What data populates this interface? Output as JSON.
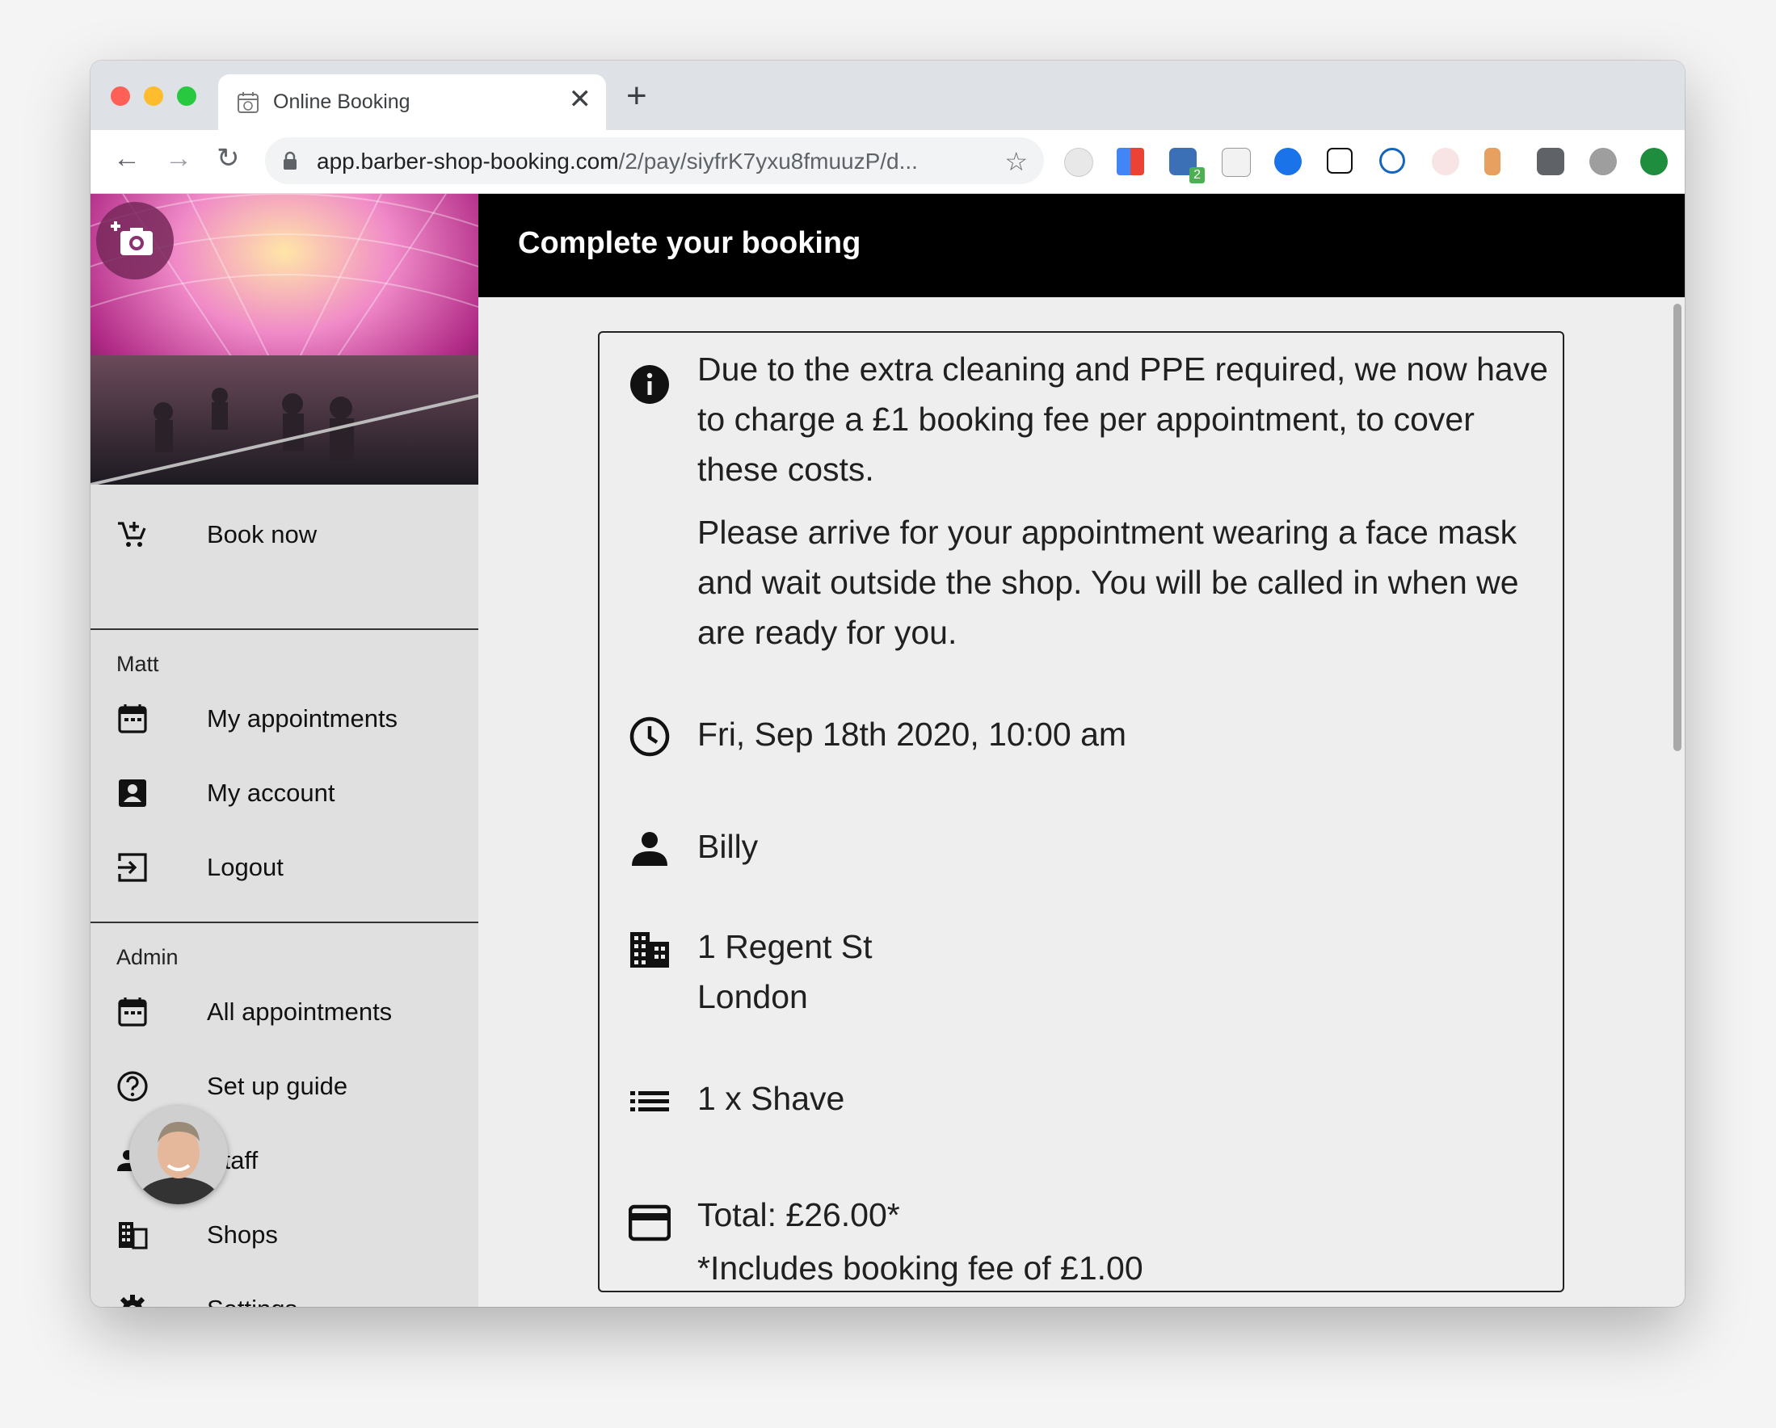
{
  "browser": {
    "tab_title": "Online Booking",
    "tab_close": "✕",
    "new_tab": "+",
    "url_main": "app.barber-shop-booking.com",
    "url_rest": "/2/pay/siyfrK7yxu8fmuuzP/d...",
    "back": "←",
    "forward": "→",
    "reload": "↻",
    "bookmark": "☆",
    "extension_badge": "2"
  },
  "sidebar": {
    "book_now": "Book now",
    "user_section": "Matt",
    "user_items": [
      "My appointments",
      "My account",
      "Logout"
    ],
    "admin_section": "Admin",
    "admin_items": [
      "All appointments",
      "Set up guide",
      "Staff",
      "Shops",
      "Settings"
    ]
  },
  "header": {
    "title": "Complete your booking"
  },
  "booking": {
    "notice_p1": "Due to the extra cleaning and PPE required, we now have to charge a £1 booking fee per appointment, to cover these costs.",
    "notice_p2": "Please arrive for your appointment wearing a face mask and wait outside the shop. You will be called in when we are ready for you.",
    "datetime": "Fri, Sep 18th 2020, 10:00 am",
    "staff": "Billy",
    "address_line1": "1 Regent St",
    "address_line2": "London",
    "service": "1 x Shave",
    "total": "Total: £26.00*",
    "fee_note": "*Includes booking fee of £1.00"
  },
  "colors": {
    "appbar": "#000000",
    "sidebar": "#e0e0e0",
    "content": "#eeeeee",
    "accent_green": "#1e8e3e"
  },
  "icons": [
    "info-icon",
    "clock-icon",
    "person-icon",
    "building-icon",
    "list-icon",
    "credit-card-icon"
  ]
}
